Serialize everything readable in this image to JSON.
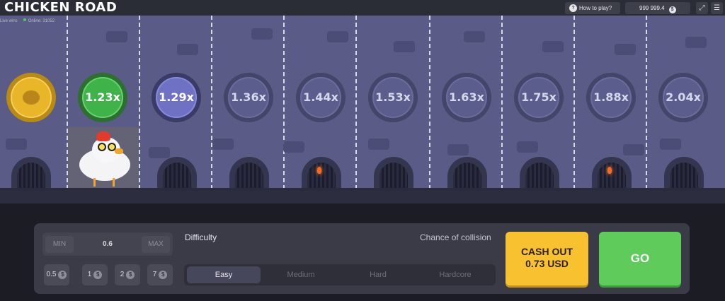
{
  "header": {
    "logo_text": "CHICKEN ROAD",
    "how_to_play": "How to play?",
    "balance": "999 999.4",
    "currency_icon": "dollar-coin-icon"
  },
  "live": {
    "live_wins_label": "Live wins",
    "online_text": "Online: 31052"
  },
  "road": {
    "multipliers": [
      "1.23x",
      "1.29x",
      "1.36x",
      "1.44x",
      "1.53x",
      "1.63x",
      "1.75x",
      "1.88x",
      "2.04x"
    ],
    "current_step": 1
  },
  "controls": {
    "min_label": "MIN",
    "max_label": "MAX",
    "bet_value": "0.6",
    "chips": [
      "0.5",
      "1",
      "2",
      "7"
    ],
    "chip_currency": "$",
    "difficulty_label": "Difficulty",
    "collision_label": "Chance of collision",
    "difficulties": [
      "Easy",
      "Medium",
      "Hard",
      "Hardcore"
    ],
    "selected_difficulty": "Easy",
    "cashout_label": "CASH OUT",
    "cashout_amount": "0.73 USD",
    "go_label": "GO"
  },
  "colors": {
    "road": "#5a5b86",
    "active_coin": "#3fb24a",
    "next_coin": "#6f71c4",
    "cashout": "#f8c12f",
    "go": "#5ecb5b"
  }
}
